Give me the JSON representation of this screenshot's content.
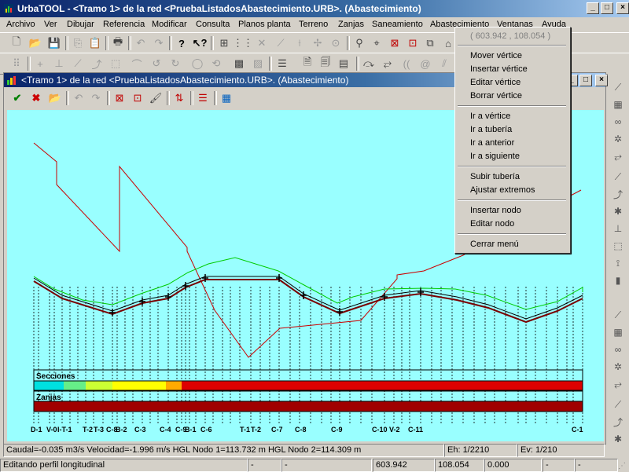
{
  "app": {
    "title": "UrbaTOOL - <Tramo 1> de la red <PruebaListadosAbastecimiento.URB>. (Abastecimiento)"
  },
  "menu": [
    "Archivo",
    "Ver",
    "Dibujar",
    "Referencia",
    "Modificar",
    "Consulta",
    "Planos planta",
    "Terreno",
    "Zanjas",
    "Saneamiento",
    "Abastecimiento",
    "Ventanas",
    "Ayuda"
  ],
  "child": {
    "title": "<Tramo 1> de la red <PruebaListadosAbastecimiento.URB>. (Abastecimiento)"
  },
  "context_menu": {
    "coords": "( 603.942 , 108.054 )",
    "group1": [
      "Mover vértice",
      "Insertar vértice",
      "Editar vértice",
      "Borrar vértice"
    ],
    "group2": [
      "Ir a vértice",
      "Ir a tubería",
      "Ir a anterior",
      "Ir a siguiente"
    ],
    "group3": [
      "Subir tubería",
      "Ajustar extremos"
    ],
    "group4": [
      "Insertar nodo",
      "Editar nodo"
    ],
    "group5": [
      "Cerrar menú"
    ]
  },
  "profile": {
    "secciones_label": "Secciones",
    "zanjas_label": "Zanjas",
    "node_labels": [
      "D-1",
      "V-0",
      "I-T-1",
      "T-2",
      "T-3",
      "C-8",
      "B-2",
      "C-3",
      "C-4",
      "C-9",
      "B-1",
      "C-6",
      "T-1",
      "T-2",
      "C-7",
      "C-8",
      "C-9",
      "C-10",
      "V-2",
      "C-11",
      "C-1"
    ],
    "colors": {
      "background": "#99ffff",
      "terrain": "#00cc00",
      "pipe": "#7a0000",
      "hgl": "#cc0000",
      "zanja": "#a00000",
      "seccion_red": "#e00000"
    }
  },
  "status": {
    "caudal": "Caudal=-0.035  m3/s  Velocidad=-1.996  m/s  HGL Nodo 1=113.732 m  HGL Nodo 2=114.309 m",
    "eh": "Eh: 1/2210",
    "ev": "Ev: 1/210",
    "mode": "Editando perfil longitudinal",
    "p2": "-",
    "p3": "-",
    "x": "603.942",
    "y": "108.054",
    "z": "0.000",
    "p7": "-",
    "p8": "-"
  },
  "window_buttons": {
    "min": "_",
    "max": "□",
    "close": "×"
  }
}
